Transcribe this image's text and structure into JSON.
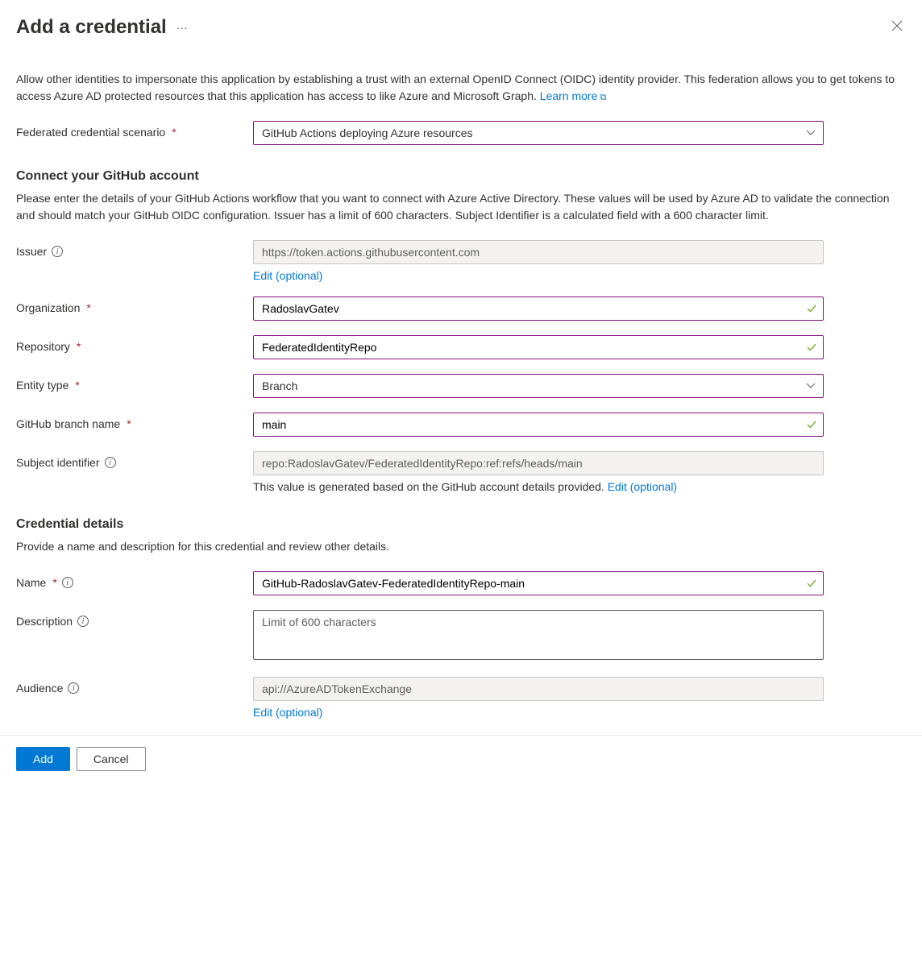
{
  "header": {
    "title": "Add a credential"
  },
  "intro": {
    "text": "Allow other identities to impersonate this application by establishing a trust with an external OpenID Connect (OIDC) identity provider. This federation allows you to get tokens to access Azure AD protected resources that this application has access to like Azure and Microsoft Graph. ",
    "link": "Learn more"
  },
  "scenario": {
    "label": "Federated credential scenario",
    "value": "GitHub Actions deploying Azure resources"
  },
  "github_section": {
    "heading": "Connect your GitHub account",
    "description": "Please enter the details of your GitHub Actions workflow that you want to connect with Azure Active Directory. These values will be used by Azure AD to validate the connection and should match your GitHub OIDC configuration. Issuer has a limit of 600 characters. Subject Identifier is a calculated field with a 600 character limit."
  },
  "issuer": {
    "label": "Issuer",
    "value": "https://token.actions.githubusercontent.com",
    "edit_link": "Edit (optional)"
  },
  "organization": {
    "label": "Organization",
    "value": "RadoslavGatev"
  },
  "repository": {
    "label": "Repository",
    "value": "FederatedIdentityRepo"
  },
  "entity_type": {
    "label": "Entity type",
    "value": "Branch"
  },
  "branch": {
    "label": "GitHub branch name",
    "value": "main"
  },
  "subject": {
    "label": "Subject identifier",
    "value": "repo:RadoslavGatev/FederatedIdentityRepo:ref:refs/heads/main",
    "helper": "This value is generated based on the GitHub account details provided. ",
    "edit_link": "Edit (optional)"
  },
  "details_section": {
    "heading": "Credential details",
    "description": "Provide a name and description for this credential and review other details."
  },
  "name_field": {
    "label": "Name",
    "value": "GitHub-RadoslavGatev-FederatedIdentityRepo-main"
  },
  "description_field": {
    "label": "Description",
    "placeholder": "Limit of 600 characters"
  },
  "audience": {
    "label": "Audience",
    "value": "api://AzureADTokenExchange",
    "edit_link": "Edit (optional)"
  },
  "footer": {
    "add": "Add",
    "cancel": "Cancel"
  }
}
